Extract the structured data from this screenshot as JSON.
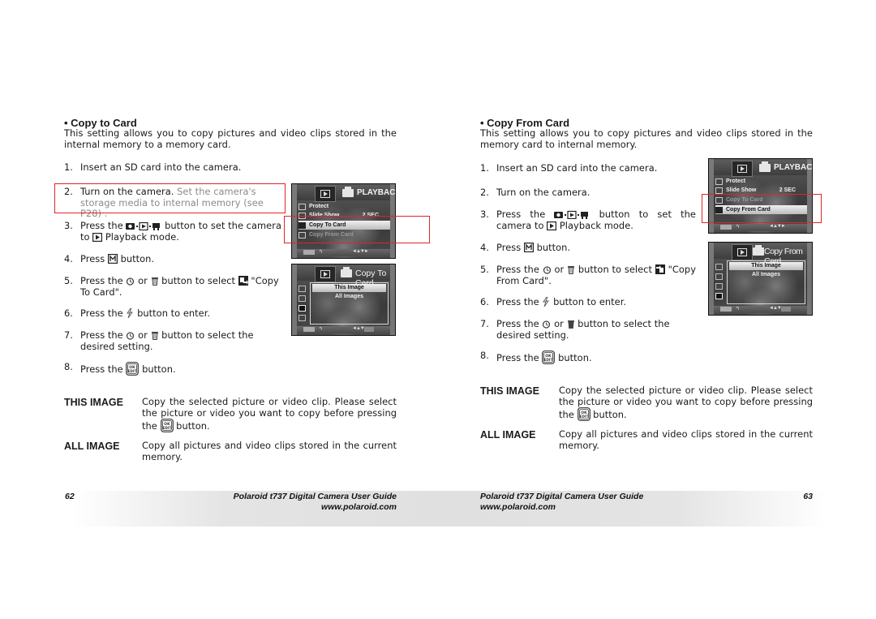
{
  "left_page": {
    "heading": "• Copy to Card",
    "intro": "This setting allows you to copy pictures and video clips stored in the internal memory to a memory card.",
    "steps": [
      {
        "num": "1.",
        "text": "Insert an SD card into the camera."
      },
      {
        "num": "2.",
        "text": "Turn on the camera.",
        "note": " Set the camera's storage media to internal memory (see P28) ."
      },
      {
        "num": "3.",
        "pre": "Press the ",
        "icon": "camera-playback-video-mode-icon",
        "post": " button to set the camera to ",
        "icon2": "playback-icon",
        "post2": " Playback mode."
      },
      {
        "num": "4.",
        "pre": "Press ",
        "icon": "menu-m-icon",
        "post": " button."
      },
      {
        "num": "5.",
        "pre": "Press the ",
        "icon": "self-timer-icon",
        "mid": " or ",
        "icon2": "trash-icon",
        "post": " button to select ",
        "icon3": "copy-to-card-icon",
        "post2": " \"Copy To Card\"."
      },
      {
        "num": "6.",
        "pre": "Press the ",
        "icon": "flash-icon",
        "post": " button to enter."
      },
      {
        "num": "7.",
        "pre": "Press the ",
        "icon": "self-timer-icon",
        "mid": " or ",
        "icon2": "trash-icon",
        "post": " button to select the desired setting."
      },
      {
        "num": "8.",
        "pre": "Press the ",
        "icon": "ok-edit-icon",
        "post": " button."
      }
    ],
    "definitions": [
      {
        "term": "THIS IMAGE",
        "desc": "Copy the selected picture or video clip. Please select the picture or video you want to copy before pressing the",
        "desc_end": " button."
      },
      {
        "term": "ALL IMAGE",
        "desc": "Copy all pictures and video clips stored in the current memory."
      }
    ],
    "screen_menu": {
      "title": "PLAYBACK",
      "items": [
        {
          "label": "Protect",
          "value": "",
          "state": "normal"
        },
        {
          "label": "Slide Show",
          "value": "2 SEC",
          "state": "normal"
        },
        {
          "label": "Copy To Card",
          "value": "",
          "state": "selected"
        },
        {
          "label": "Copy From Card",
          "value": "",
          "state": "dim"
        }
      ],
      "nav_arrows": "◄▲▼►"
    },
    "screen_sub": {
      "title": "Copy To Card",
      "options": [
        {
          "label": "This Image",
          "state": "selected"
        },
        {
          "label": "All Images",
          "state": "normal"
        }
      ],
      "nav_arrows": "◄▲▼"
    },
    "footer": {
      "page_number": "62",
      "guide_title": "Polaroid t737 Digital Camera User Guide",
      "website": "www.polaroid.com"
    }
  },
  "right_page": {
    "heading": "• Copy From Card",
    "intro": "This setting allows you to copy pictures and video clips stored in the memory card to internal memory.",
    "steps": [
      {
        "num": "1.",
        "text": "Insert an SD card into the camera."
      },
      {
        "num": "2.",
        "text": "Turn on the camera."
      },
      {
        "num": "3.",
        "pre": "Press the ",
        "post": " button to set the camera to ",
        "post2": " Playback mode."
      },
      {
        "num": "4.",
        "pre": "Press ",
        "post": " button."
      },
      {
        "num": "5.",
        "pre": "Press the ",
        "mid": " or ",
        "post": " button to select ",
        "post2": " \"Copy From Card\"."
      },
      {
        "num": "6.",
        "pre": "Press the ",
        "post": " button to enter."
      },
      {
        "num": "7.",
        "pre": "Press the ",
        "mid": " or ",
        "post": " button to select the desired setting."
      },
      {
        "num": "8.",
        "pre": "Press the ",
        "post": " button."
      }
    ],
    "definitions": [
      {
        "term": "THIS IMAGE",
        "desc": "Copy the selected picture or video clip. Please select the picture or video you want to copy before pressing the",
        "desc_end": " button."
      },
      {
        "term": "ALL IMAGE",
        "desc": "Copy all pictures and video clips stored in the current memory."
      }
    ],
    "screen_menu": {
      "title": "PLAYBACK",
      "items": [
        {
          "label": "Protect",
          "value": "",
          "state": "normal"
        },
        {
          "label": "Slide Show",
          "value": "2 SEC",
          "state": "normal"
        },
        {
          "label": "Copy To Card",
          "value": "",
          "state": "dim"
        },
        {
          "label": "Copy From Card",
          "value": "",
          "state": "selected"
        }
      ],
      "nav_arrows": "◄▲▼►"
    },
    "screen_sub": {
      "title": "Copy From Card",
      "options": [
        {
          "label": "This Image",
          "state": "selected"
        },
        {
          "label": "All Images",
          "state": "normal"
        }
      ],
      "nav_arrows": "◄▲▼"
    },
    "footer": {
      "page_number": "63",
      "guide_title": "Polaroid t737 Digital Camera User Guide",
      "website": "www.polaroid.com"
    }
  },
  "annotations": {
    "highlight_color": "#e0242a"
  }
}
